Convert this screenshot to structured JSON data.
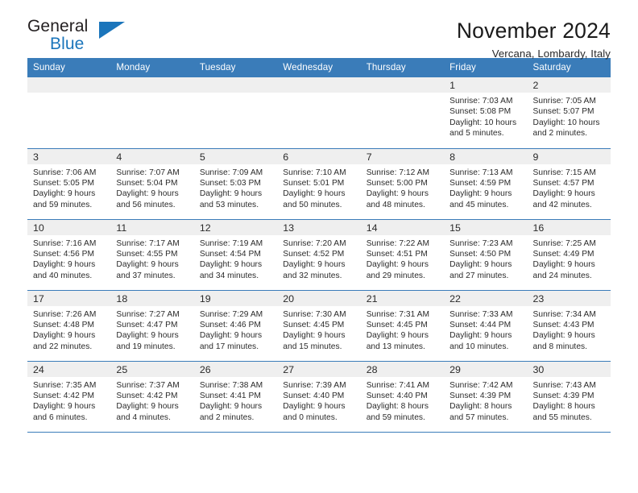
{
  "brand": {
    "name_part1": "General",
    "name_part2": "Blue",
    "triangle_icon": "blue-triangle-logo-mark",
    "accent_color": "#1b75bb"
  },
  "header": {
    "title": "November 2024",
    "subtitle": "Vercana, Lombardy, Italy"
  },
  "theme": {
    "header_blue": "#3a7cb9",
    "daynum_band_gray": "#efefef",
    "text_color": "#2a2a2a"
  },
  "calendar": {
    "weekday_headers": [
      "Sunday",
      "Monday",
      "Tuesday",
      "Wednesday",
      "Thursday",
      "Friday",
      "Saturday"
    ],
    "weeks": [
      [
        {
          "day": "",
          "lines": []
        },
        {
          "day": "",
          "lines": []
        },
        {
          "day": "",
          "lines": []
        },
        {
          "day": "",
          "lines": []
        },
        {
          "day": "",
          "lines": []
        },
        {
          "day": "1",
          "lines": [
            "Sunrise: 7:03 AM",
            "Sunset: 5:08 PM",
            "Daylight: 10 hours",
            "and 5 minutes."
          ]
        },
        {
          "day": "2",
          "lines": [
            "Sunrise: 7:05 AM",
            "Sunset: 5:07 PM",
            "Daylight: 10 hours",
            "and 2 minutes."
          ]
        }
      ],
      [
        {
          "day": "3",
          "lines": [
            "Sunrise: 7:06 AM",
            "Sunset: 5:05 PM",
            "Daylight: 9 hours",
            "and 59 minutes."
          ]
        },
        {
          "day": "4",
          "lines": [
            "Sunrise: 7:07 AM",
            "Sunset: 5:04 PM",
            "Daylight: 9 hours",
            "and 56 minutes."
          ]
        },
        {
          "day": "5",
          "lines": [
            "Sunrise: 7:09 AM",
            "Sunset: 5:03 PM",
            "Daylight: 9 hours",
            "and 53 minutes."
          ]
        },
        {
          "day": "6",
          "lines": [
            "Sunrise: 7:10 AM",
            "Sunset: 5:01 PM",
            "Daylight: 9 hours",
            "and 50 minutes."
          ]
        },
        {
          "day": "7",
          "lines": [
            "Sunrise: 7:12 AM",
            "Sunset: 5:00 PM",
            "Daylight: 9 hours",
            "and 48 minutes."
          ]
        },
        {
          "day": "8",
          "lines": [
            "Sunrise: 7:13 AM",
            "Sunset: 4:59 PM",
            "Daylight: 9 hours",
            "and 45 minutes."
          ]
        },
        {
          "day": "9",
          "lines": [
            "Sunrise: 7:15 AM",
            "Sunset: 4:57 PM",
            "Daylight: 9 hours",
            "and 42 minutes."
          ]
        }
      ],
      [
        {
          "day": "10",
          "lines": [
            "Sunrise: 7:16 AM",
            "Sunset: 4:56 PM",
            "Daylight: 9 hours",
            "and 40 minutes."
          ]
        },
        {
          "day": "11",
          "lines": [
            "Sunrise: 7:17 AM",
            "Sunset: 4:55 PM",
            "Daylight: 9 hours",
            "and 37 minutes."
          ]
        },
        {
          "day": "12",
          "lines": [
            "Sunrise: 7:19 AM",
            "Sunset: 4:54 PM",
            "Daylight: 9 hours",
            "and 34 minutes."
          ]
        },
        {
          "day": "13",
          "lines": [
            "Sunrise: 7:20 AM",
            "Sunset: 4:52 PM",
            "Daylight: 9 hours",
            "and 32 minutes."
          ]
        },
        {
          "day": "14",
          "lines": [
            "Sunrise: 7:22 AM",
            "Sunset: 4:51 PM",
            "Daylight: 9 hours",
            "and 29 minutes."
          ]
        },
        {
          "day": "15",
          "lines": [
            "Sunrise: 7:23 AM",
            "Sunset: 4:50 PM",
            "Daylight: 9 hours",
            "and 27 minutes."
          ]
        },
        {
          "day": "16",
          "lines": [
            "Sunrise: 7:25 AM",
            "Sunset: 4:49 PM",
            "Daylight: 9 hours",
            "and 24 minutes."
          ]
        }
      ],
      [
        {
          "day": "17",
          "lines": [
            "Sunrise: 7:26 AM",
            "Sunset: 4:48 PM",
            "Daylight: 9 hours",
            "and 22 minutes."
          ]
        },
        {
          "day": "18",
          "lines": [
            "Sunrise: 7:27 AM",
            "Sunset: 4:47 PM",
            "Daylight: 9 hours",
            "and 19 minutes."
          ]
        },
        {
          "day": "19",
          "lines": [
            "Sunrise: 7:29 AM",
            "Sunset: 4:46 PM",
            "Daylight: 9 hours",
            "and 17 minutes."
          ]
        },
        {
          "day": "20",
          "lines": [
            "Sunrise: 7:30 AM",
            "Sunset: 4:45 PM",
            "Daylight: 9 hours",
            "and 15 minutes."
          ]
        },
        {
          "day": "21",
          "lines": [
            "Sunrise: 7:31 AM",
            "Sunset: 4:45 PM",
            "Daylight: 9 hours",
            "and 13 minutes."
          ]
        },
        {
          "day": "22",
          "lines": [
            "Sunrise: 7:33 AM",
            "Sunset: 4:44 PM",
            "Daylight: 9 hours",
            "and 10 minutes."
          ]
        },
        {
          "day": "23",
          "lines": [
            "Sunrise: 7:34 AM",
            "Sunset: 4:43 PM",
            "Daylight: 9 hours",
            "and 8 minutes."
          ]
        }
      ],
      [
        {
          "day": "24",
          "lines": [
            "Sunrise: 7:35 AM",
            "Sunset: 4:42 PM",
            "Daylight: 9 hours",
            "and 6 minutes."
          ]
        },
        {
          "day": "25",
          "lines": [
            "Sunrise: 7:37 AM",
            "Sunset: 4:42 PM",
            "Daylight: 9 hours",
            "and 4 minutes."
          ]
        },
        {
          "day": "26",
          "lines": [
            "Sunrise: 7:38 AM",
            "Sunset: 4:41 PM",
            "Daylight: 9 hours",
            "and 2 minutes."
          ]
        },
        {
          "day": "27",
          "lines": [
            "Sunrise: 7:39 AM",
            "Sunset: 4:40 PM",
            "Daylight: 9 hours",
            "and 0 minutes."
          ]
        },
        {
          "day": "28",
          "lines": [
            "Sunrise: 7:41 AM",
            "Sunset: 4:40 PM",
            "Daylight: 8 hours",
            "and 59 minutes."
          ]
        },
        {
          "day": "29",
          "lines": [
            "Sunrise: 7:42 AM",
            "Sunset: 4:39 PM",
            "Daylight: 8 hours",
            "and 57 minutes."
          ]
        },
        {
          "day": "30",
          "lines": [
            "Sunrise: 7:43 AM",
            "Sunset: 4:39 PM",
            "Daylight: 8 hours",
            "and 55 minutes."
          ]
        }
      ]
    ]
  }
}
